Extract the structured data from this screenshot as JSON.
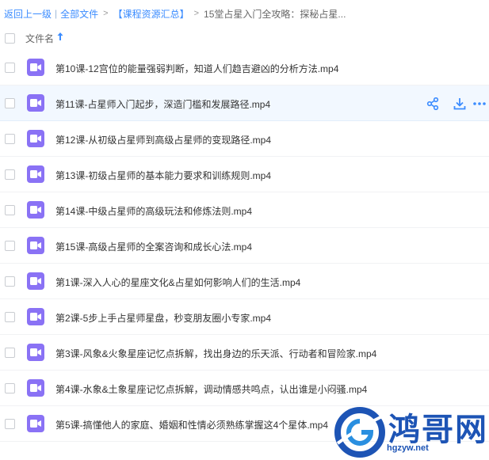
{
  "breadcrumb": {
    "back": "返回上一级",
    "all_files": "全部文件",
    "folder": "【课程资源汇总】",
    "current": "15堂占星入门全攻略：探秘占星..."
  },
  "header": {
    "column_name": "文件名"
  },
  "files": [
    "第10课-12宫位的能量强弱判断，知道人们趋吉避凶的分析方法.mp4",
    "第11课-占星师入门起步，深造门槛和发展路径.mp4",
    "第12课-从初级占星师到高级占星师的变现路径.mp4",
    "第13课-初级占星师的基本能力要求和训练规则.mp4",
    "第14课-中级占星师的高级玩法和修炼法则.mp4",
    "第15课-高级占星师的全案咨询和成长心法.mp4",
    "第1课-深入人心的星座文化&占星如何影响人们的生活.mp4",
    "第2课-5步上手占星师星盘，秒变朋友圈小专家.mp4",
    "第3课-风象&火象星座记忆点拆解，找出身边的乐天派、行动者和冒险家.mp4",
    "第4课-水象&土象星座记忆点拆解，调动情感共鸣点，认出谁是小闷骚.mp4",
    "第5课-搞懂他人的家庭、婚姻和性情必须熟练掌握这4个星体.mp4"
  ],
  "hover_row_index": 1,
  "watermark": {
    "brand": "鸿哥网",
    "url": "hgzyw.net"
  },
  "colors": {
    "link": "#3b8cff",
    "video_icon": "#8a72f5",
    "hover_row": "#f2f8ff",
    "action_icon": "#3b8cff"
  }
}
